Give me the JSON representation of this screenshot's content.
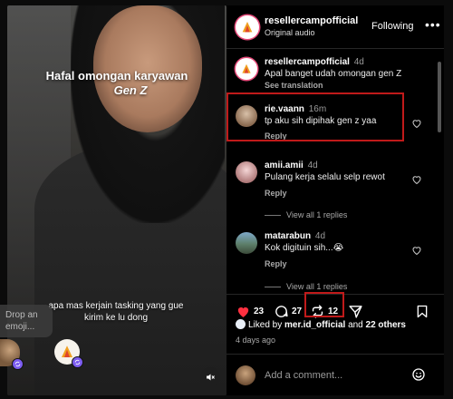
{
  "video": {
    "caption_line1": "Hafal omongan karyawan",
    "caption_line2": "Gen Z",
    "subtitle_line1": "apa mas kerjain tasking yang gue",
    "subtitle_line2": "kirim ke lu dong",
    "drop_emoji_placeholder": "Drop an emoji..."
  },
  "header": {
    "username": "resellercampofficial",
    "audio": "Original audio",
    "follow_status": "Following",
    "more": "•••"
  },
  "comments": [
    {
      "user": "resellercampofficial",
      "time": "4d",
      "text": "Apal banget udah omongan gen Z",
      "action": "See translation"
    },
    {
      "user": "rie.vaann",
      "time": "16m",
      "text": "tp aku sih dipihak gen z yaa",
      "action": "Reply"
    },
    {
      "user": "amii.amii",
      "time": "4d",
      "text": "Pulang kerja selalu selp rewot",
      "action": "Reply",
      "view_replies": "View all 1 replies"
    },
    {
      "user": "matarabun",
      "time": "4d",
      "text": "Kok digituin sih...😭",
      "action": "Reply",
      "view_replies": "View all 1 replies"
    }
  ],
  "actions": {
    "likes": "23",
    "comments": "27",
    "reposts": "12"
  },
  "liked_by": {
    "prefix": "Liked by",
    "user": "mer.id_official",
    "middle": "and",
    "others": "22 others"
  },
  "posted_ago": "4 days ago",
  "add_comment_placeholder": "Add a comment...",
  "colors": {
    "highlight_box": "#c01a1a",
    "like_red": "#ff3040",
    "badge_purple": "#7c5cf0"
  }
}
